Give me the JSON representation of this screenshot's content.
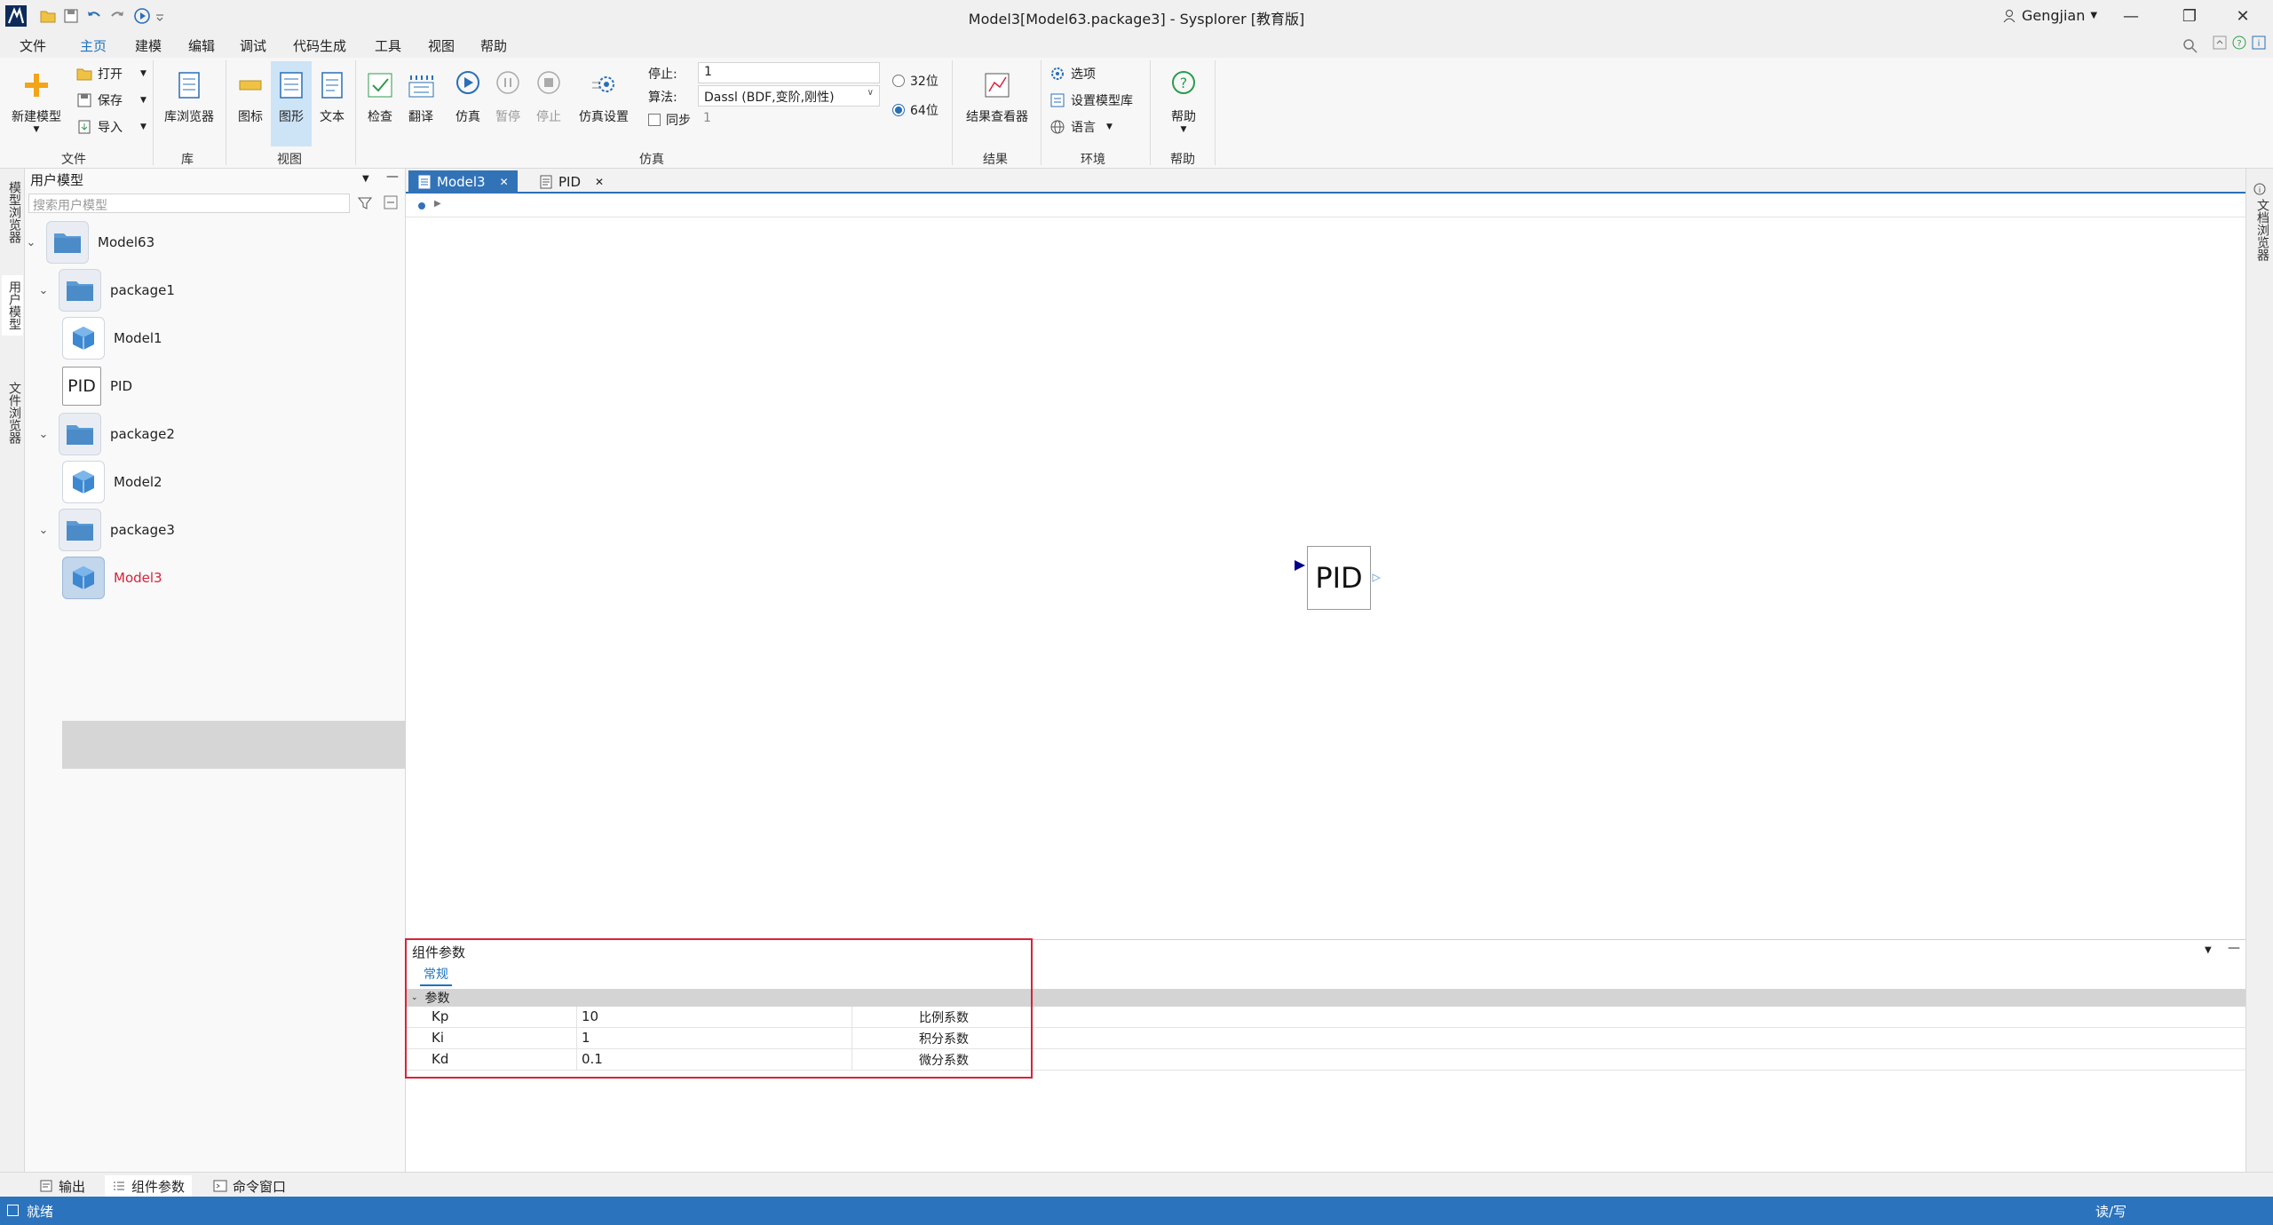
{
  "window": {
    "title": "Model3[Model63.package3] - Sysplorer [教育版]",
    "user": "Gengjian"
  },
  "menu": [
    "文件",
    "主页",
    "建模",
    "编辑",
    "调试",
    "代码生成",
    "工具",
    "视图",
    "帮助"
  ],
  "search": {
    "placeholder": "搜索"
  },
  "ribbon": {
    "file": {
      "new_model": "新建模型",
      "open": "打开",
      "save": "保存",
      "import": "导入",
      "group": "文件"
    },
    "lib": {
      "browser": "库浏览器",
      "group": "库"
    },
    "view": {
      "icon": "图标",
      "diagram": "图形",
      "text": "文本",
      "group": "视图"
    },
    "sim": {
      "check": "检查",
      "translate": "翻译",
      "simulate": "仿真",
      "pause": "暂停",
      "stop": "停止",
      "settings": "仿真设置",
      "stop_label": "停止:",
      "stop_value": "1",
      "algo_label": "算法:",
      "algo_value": "Dassl (BDF,变阶,刚性)",
      "sync_label": "同步",
      "sync_value": "1",
      "bit32": "32位",
      "bit64": "64位",
      "group": "仿真"
    },
    "result": {
      "viewer": "结果查看器",
      "group": "结果"
    },
    "env": {
      "options": "选项",
      "set_lib": "设置模型库",
      "language": "语言",
      "group": "环境"
    },
    "help": {
      "help": "帮助",
      "group": "帮助"
    }
  },
  "left_tabs": [
    "模型浏览器",
    "用户模型",
    "文件浏览器"
  ],
  "right_tabs": [
    "文档浏览器"
  ],
  "tree": {
    "title": "用户模型",
    "search_placeholder": "搜索用户模型",
    "nodes": [
      {
        "label": "Model63",
        "type": "folder"
      },
      {
        "label": "package1",
        "type": "folder"
      },
      {
        "label": "Model1",
        "type": "model"
      },
      {
        "label": "PID",
        "type": "pid",
        "icon_text": "PID"
      },
      {
        "label": "package2",
        "type": "folder"
      },
      {
        "label": "Model2",
        "type": "model"
      },
      {
        "label": "package3",
        "type": "folder"
      },
      {
        "label": "Model3",
        "type": "model"
      }
    ]
  },
  "doc_tabs": [
    {
      "label": "Model3"
    },
    {
      "label": "PID"
    }
  ],
  "canvas": {
    "component_label": "PID"
  },
  "params": {
    "title": "组件参数",
    "tab": "常规",
    "group": "参数",
    "rows": [
      {
        "name": "Kp",
        "value": "10",
        "desc": "比例系数"
      },
      {
        "name": "Ki",
        "value": "1",
        "desc": "积分系数"
      },
      {
        "name": "Kd",
        "value": "0.1",
        "desc": "微分系数"
      }
    ]
  },
  "bottom_tabs": [
    "输出",
    "组件参数",
    "命令窗口"
  ],
  "status": {
    "left": "就绪",
    "right": "读/写"
  },
  "colors": {
    "accent": "#2b73bd",
    "highlight_border": "#d9223a",
    "selected_model_text": "#d9223a"
  }
}
